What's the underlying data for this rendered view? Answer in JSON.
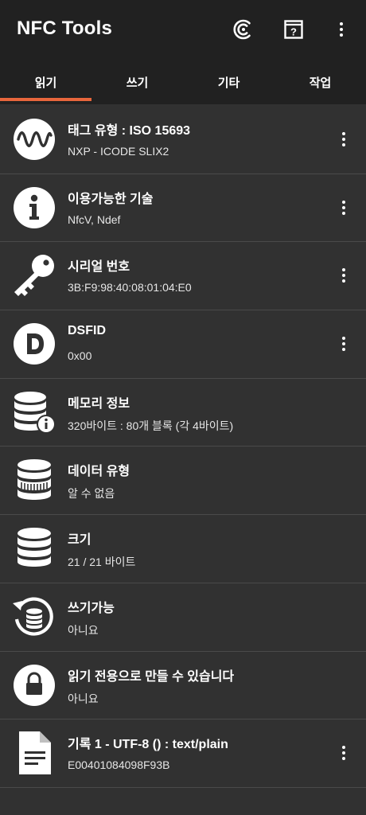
{
  "app": {
    "title": "NFC Tools"
  },
  "appbar_actions": [
    "nfc-scan-icon",
    "help-icon",
    "more-vert-icon"
  ],
  "tabs": [
    {
      "label": "읽기",
      "selected": true
    },
    {
      "label": "쓰기",
      "selected": false
    },
    {
      "label": "기타",
      "selected": false
    },
    {
      "label": "작업",
      "selected": false
    }
  ],
  "colors": {
    "accent": "#e8663c",
    "bar": "#212121",
    "background": "#313131"
  },
  "rows": [
    {
      "icon": "wave-icon",
      "title": "태그 유형 : ISO 15693",
      "value": "NXP - ICODE SLIX2",
      "has_menu": true
    },
    {
      "icon": "info-icon",
      "title": "이용가능한 기술",
      "value": "NfcV, Ndef",
      "has_menu": true
    },
    {
      "icon": "key-icon",
      "title": "시리얼 번호",
      "value": "3B:F9:98:40:08:01:04:E0",
      "has_menu": true
    },
    {
      "icon": "d-letter-icon",
      "title": "DSFID",
      "value": "0x00",
      "has_menu": true
    },
    {
      "icon": "database-info-icon",
      "title": "메모리 정보",
      "value": "320바이트 : 80개 블록 (각 4바이트)",
      "has_menu": false
    },
    {
      "icon": "database-striped-icon",
      "title": "데이터 유형",
      "value": "알 수 없음",
      "has_menu": false
    },
    {
      "icon": "database-icon",
      "title": "크기",
      "value": "21 / 21 바이트",
      "has_menu": false
    },
    {
      "icon": "database-rewrite-icon",
      "title": "쓰기가능",
      "value": "아니요",
      "has_menu": false
    },
    {
      "icon": "lock-icon",
      "title": "읽기 전용으로 만들 수 있습니다",
      "value": "아니요",
      "has_menu": false
    },
    {
      "icon": "document-icon",
      "title": "기록 1 - UTF-8 () : text/plain",
      "value": "E00401084098F93B",
      "has_menu": true
    }
  ]
}
